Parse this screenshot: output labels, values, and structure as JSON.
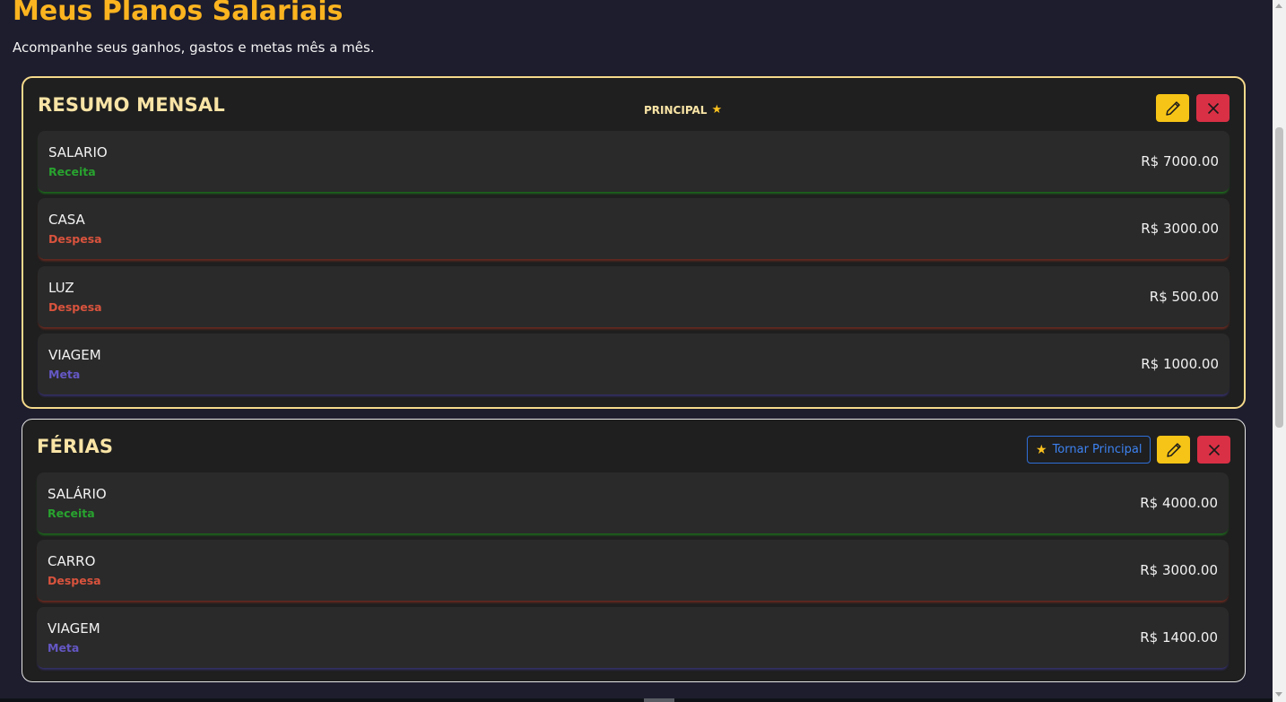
{
  "header": {
    "title": "Meus Planos Salariais",
    "subtitle": "Acompanhe seus ganhos, gastos e metas mês a mês."
  },
  "plans": [
    {
      "name": "RESUMO MENSAL",
      "badge": "PRINCIPAL",
      "badge_icon": "star-icon",
      "entries": [
        {
          "name": "SALARIO",
          "type": "Receita",
          "amount": "R$ 7000.00"
        },
        {
          "name": "CASA",
          "type": "Despesa",
          "amount": "R$ 3000.00"
        },
        {
          "name": "LUZ",
          "type": "Despesa",
          "amount": "R$ 500.00"
        },
        {
          "name": "VIAGEM",
          "type": "Meta",
          "amount": "R$ 1000.00"
        }
      ]
    },
    {
      "name": "FÉRIAS",
      "make_main_label": "Tornar Principal",
      "entries": [
        {
          "name": "SALÁRIO",
          "type": "Receita",
          "amount": "R$ 4000.00"
        },
        {
          "name": "CARRO",
          "type": "Despesa",
          "amount": "R$ 3000.00"
        },
        {
          "name": "VIAGEM",
          "type": "Meta",
          "amount": "R$ 1400.00"
        }
      ]
    }
  ],
  "colors": {
    "title": "#fbb41f",
    "receita": "#28a32f",
    "despesa": "#d9533d",
    "meta": "#6457c4",
    "edit_button": "#f6c416",
    "delete_button": "#d93045",
    "main_border": "#f5d98b"
  }
}
